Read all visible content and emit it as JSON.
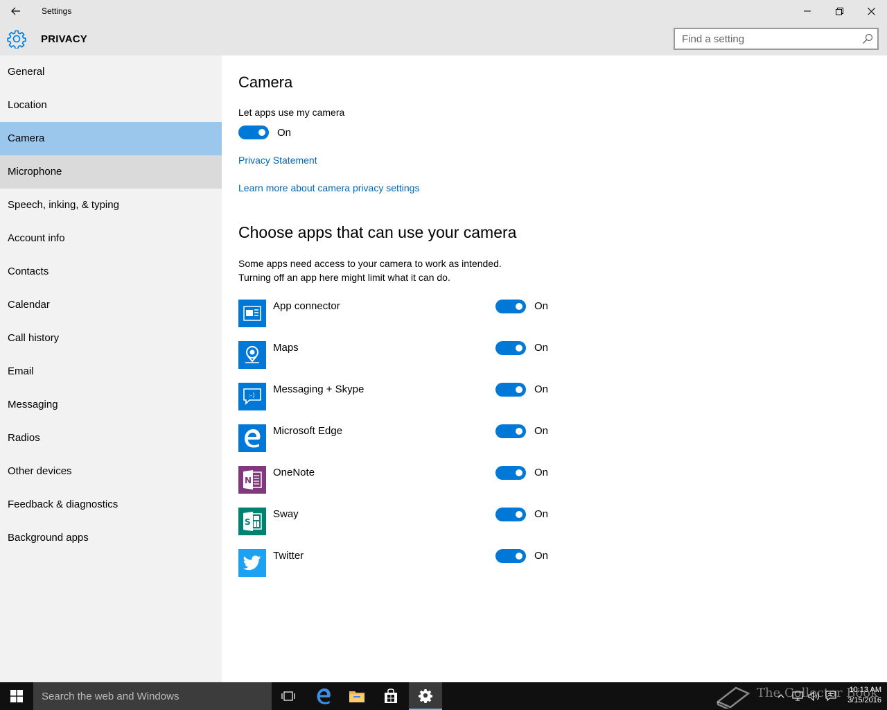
{
  "window": {
    "title": "Settings"
  },
  "header": {
    "title": "PRIVACY",
    "search_placeholder": "Find a setting"
  },
  "sidebar": {
    "items": [
      {
        "label": "General"
      },
      {
        "label": "Location"
      },
      {
        "label": "Camera",
        "selected": true
      },
      {
        "label": "Microphone"
      },
      {
        "label": "Speech, inking, & typing"
      },
      {
        "label": "Account info"
      },
      {
        "label": "Contacts"
      },
      {
        "label": "Calendar"
      },
      {
        "label": "Call history"
      },
      {
        "label": "Email"
      },
      {
        "label": "Messaging"
      },
      {
        "label": "Radios"
      },
      {
        "label": "Other devices"
      },
      {
        "label": "Feedback & diagnostics"
      },
      {
        "label": "Background apps"
      }
    ]
  },
  "main": {
    "title": "Camera",
    "master_toggle": {
      "label": "Let apps use my camera",
      "state": "On"
    },
    "privacy_link": "Privacy Statement",
    "learn_more_link": "Learn more about camera privacy settings",
    "apps_section_title": "Choose apps that can use your camera",
    "description_line1": "Some apps need access to your camera to work as intended.",
    "description_line2": "Turning off an app here might limit what it can do.",
    "apps": [
      {
        "name": "App connector",
        "state": "On",
        "icon": "app-connector-icon",
        "color": "#0078d7"
      },
      {
        "name": "Maps",
        "state": "On",
        "icon": "maps-icon",
        "color": "#0078d7"
      },
      {
        "name": "Messaging + Skype",
        "state": "On",
        "icon": "messaging-icon",
        "color": "#0078d7"
      },
      {
        "name": "Microsoft Edge",
        "state": "On",
        "icon": "edge-icon",
        "color": "#0078d7"
      },
      {
        "name": "OneNote",
        "state": "On",
        "icon": "onenote-icon",
        "color": "#80397b"
      },
      {
        "name": "Sway",
        "state": "On",
        "icon": "sway-icon",
        "color": "#008272"
      },
      {
        "name": "Twitter",
        "state": "On",
        "icon": "twitter-icon",
        "color": "#1da1f2"
      }
    ]
  },
  "taskbar": {
    "search_placeholder": "Search the web and Windows",
    "time": "10:13 AM",
    "date": "3/15/2016",
    "watermark": "The Collector Book"
  },
  "colors": {
    "accent": "#0078d7",
    "selected_nav": "#9cc7ec",
    "link": "#0066b4"
  }
}
